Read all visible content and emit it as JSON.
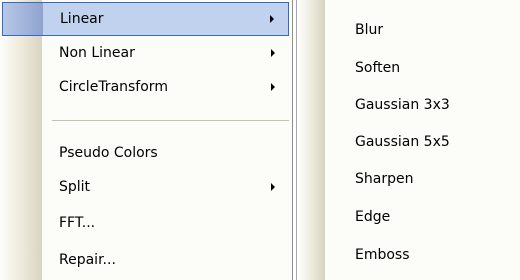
{
  "main_menu": {
    "items": [
      {
        "label": "Linear",
        "has_submenu": true,
        "highlighted": true
      },
      {
        "label": "Non Linear",
        "has_submenu": true
      },
      {
        "label": "CircleTransform",
        "has_submenu": true
      },
      {
        "label": "Pseudo Colors",
        "has_submenu": false
      },
      {
        "label": "Split",
        "has_submenu": true
      },
      {
        "label": "FFT...",
        "has_submenu": false
      },
      {
        "label": "Repair...",
        "has_submenu": false
      }
    ]
  },
  "submenu": {
    "items": [
      {
        "label": "Blur"
      },
      {
        "label": "Soften"
      },
      {
        "label": "Gaussian 3x3"
      },
      {
        "label": "Gaussian 5x5"
      },
      {
        "label": "Sharpen"
      },
      {
        "label": "Edge"
      },
      {
        "label": "Emboss"
      }
    ]
  },
  "colors": {
    "highlight_fill": "#c1d2ee",
    "highlight_border": "#316ac5",
    "menu_background": "#fcfcf9",
    "gutter": "#ece9d8"
  }
}
